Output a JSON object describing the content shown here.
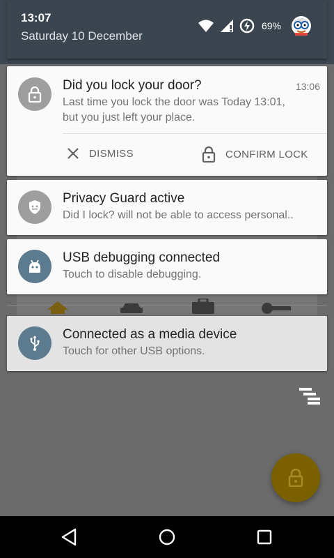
{
  "status": {
    "time": "13:07",
    "date": "Saturday 10 December",
    "battery_percent": "69%",
    "icons": [
      "wifi-icon",
      "cell-signal-icon",
      "battery-saver-icon",
      "avatar"
    ]
  },
  "notifications": [
    {
      "icon": "lock-icon",
      "title": "Did you lock your door?",
      "time": "13:06",
      "text_line1": "Last time you lock the door was Today 13:01,",
      "text_line2": "but you just left your place.",
      "actions": [
        {
          "icon": "close-icon",
          "label": "DISMISS"
        },
        {
          "icon": "lock-icon",
          "label": "CONFIRM LOCK"
        }
      ]
    },
    {
      "icon": "privacy-guard-icon",
      "title": "Privacy Guard active",
      "text": "Did I lock? will not be able to access personal.."
    },
    {
      "icon": "android-debug-icon",
      "title": "USB debugging connected",
      "text": "Touch to disable debugging."
    },
    {
      "icon": "usb-icon",
      "title": "Connected as a media device",
      "text": "Touch for other USB options."
    }
  ],
  "controls": {
    "collapse_icon": "collapse-icon",
    "fab_icon": "lock-icon"
  },
  "navbar": {
    "buttons": [
      "back-icon",
      "home-icon",
      "recents-icon"
    ]
  },
  "colors": {
    "shade_header": "#3a4550",
    "icon_grey": "#9e9e9e",
    "icon_slate": "#5c7b8f",
    "fab": "#7b6000"
  }
}
